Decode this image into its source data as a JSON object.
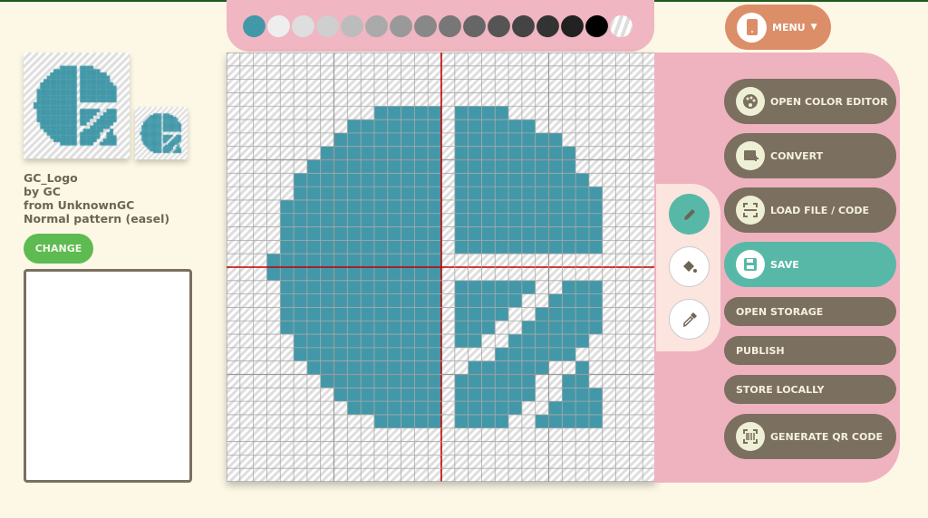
{
  "palette": {
    "colors": [
      "#4298a8",
      "#eeeeee",
      "#dedede",
      "#cfcfcf",
      "#bcbcbc",
      "#aaaaaa",
      "#999999",
      "#888888",
      "#777777",
      "#666666",
      "#555555",
      "#444444",
      "#333333",
      "#222222",
      "#000000",
      "transparent"
    ],
    "selected_index": 0
  },
  "pattern": {
    "name": "GC_Logo",
    "by": "by GC",
    "from": "from UnknownGC",
    "type": "Normal pattern (easel)",
    "fill_color": "#4298a8",
    "rows": [
      "................................",
      "................................",
      "................................",
      "................................",
      "...........11111.1111...........",
      ".........1111111.111111.........",
      "........11111111.11111111.......",
      ".......111111111.111111111......",
      "......1111111111.111111111......",
      ".....11111111111.1111111111.....",
      ".....11111111111.11111111111....",
      "....111111111111.11111111111....",
      "....111111111111.11111111111....",
      "....111111111111.11111111111....",
      "....111111111111.11111111111....",
      "...1111111111111................",
      "...1111111111111................",
      "....111111111111.111111..111....",
      "....111111111111.11111..1111....",
      "....111111111111.1111..11111....",
      "....111111111111.111..111111....",
      ".....11111111111.11..111111.....",
      ".....11111111111....111111......",
      "......1111111111..111111..1.....",
      ".......111111111.111111..11.....",
      "........11111111.111111..111....",
      ".........1111111.11111..1111....",
      "...........11111.1111..11111....",
      "................................",
      "................................",
      "................................",
      "................................"
    ]
  },
  "sidebar": {
    "change_label": "CHANGE",
    "notes_value": ""
  },
  "menu": {
    "label": "MENU",
    "icon": "phone-icon"
  },
  "tools": [
    {
      "name": "pencil",
      "icon": "pencil-icon",
      "active": true
    },
    {
      "name": "fill",
      "icon": "paint-bucket-icon",
      "active": false
    },
    {
      "name": "eyedropper",
      "icon": "eyedropper-icon",
      "active": false
    }
  ],
  "actions": {
    "open_color_editor": "OPEN COLOR EDITOR",
    "convert": "CONVERT",
    "load_file": "LOAD FILE / CODE",
    "save": "SAVE",
    "open_storage": "OPEN STORAGE",
    "publish": "PUBLISH",
    "store_locally": "STORE LOCALLY",
    "generate_qr": "GENERATE QR CODE"
  },
  "colors": {
    "accent_teal": "#58b8a8",
    "button_brown": "#7b6f5f",
    "menu_orange": "#dc8e69",
    "panel_pink": "#efb3bf",
    "change_green": "#5dbb52"
  }
}
